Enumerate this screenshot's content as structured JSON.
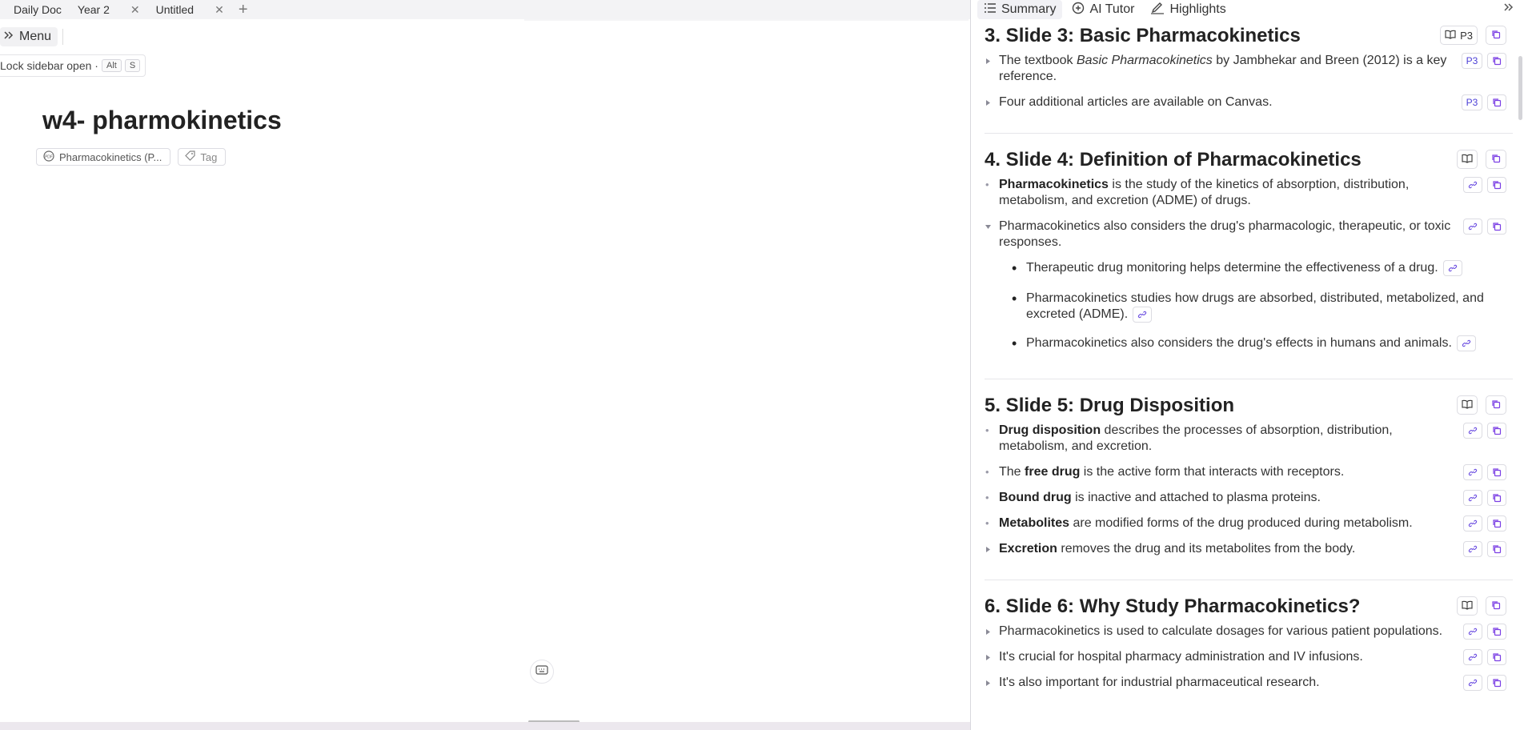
{
  "tabs": [
    {
      "label": "Daily Doc",
      "closable": false
    },
    {
      "label": "Year 2",
      "closable": true
    },
    {
      "label": "Untitled",
      "closable": true
    }
  ],
  "sidebar": {
    "menu_label": "Menu",
    "lock_tip": "Lock sidebar open ·",
    "lock_keys": [
      "Alt",
      "S"
    ]
  },
  "document": {
    "title": "w4- pharmokinetics",
    "pdf_chip": "Pharmacokinetics (P...",
    "tag_chip": "Tag"
  },
  "panel": {
    "tabs": [
      {
        "label": "Summary",
        "icon": "list-icon"
      },
      {
        "label": "AI Tutor",
        "icon": "plus-circle-icon"
      },
      {
        "label": "Highlights",
        "icon": "highlighter-icon"
      }
    ],
    "sections": [
      {
        "title": "3. Slide 3: Basic Pharmacokinetics",
        "page_badge": "P3",
        "items": [
          {
            "marker": "caret",
            "html": "The textbook <i>Basic Pharmacokinetics</i> by Jambhekar and Breen (2012) is a key reference.",
            "badge": "P3"
          },
          {
            "marker": "caret",
            "html": "Four additional articles are available on Canvas.",
            "badge": "P3"
          }
        ]
      },
      {
        "title": "4. Slide 4: Definition of Pharmacokinetics",
        "items": [
          {
            "marker": "dot",
            "html": "<b>Pharmacokinetics</b> is the study of the kinetics of absorption, distribution, metabolism, and excretion (ADME) of drugs."
          },
          {
            "marker": "open",
            "html": "Pharmacokinetics also considers the drug's pharmacologic, therapeutic, or toxic responses.",
            "sub": [
              "Therapeutic drug monitoring helps determine the effectiveness of a drug.",
              "Pharmacokinetics studies how drugs are absorbed, distributed, metabolized, and excreted (ADME).",
              "Pharmacokinetics also considers the drug's effects in humans and animals."
            ]
          }
        ]
      },
      {
        "title": "5. Slide 5: Drug Disposition",
        "items": [
          {
            "marker": "dot",
            "html": "<b>Drug disposition</b> describes the processes of absorption, distribution, metabolism, and excretion."
          },
          {
            "marker": "dot",
            "html": "The <b>free drug</b> is the active form that interacts with receptors."
          },
          {
            "marker": "dot",
            "html": "<b>Bound drug</b> is inactive and attached to plasma proteins."
          },
          {
            "marker": "dot",
            "html": "<b>Metabolites</b> are modified forms of the drug produced during metabolism."
          },
          {
            "marker": "caret",
            "html": "<b>Excretion</b> removes the drug and its metabolites from the body."
          }
        ]
      },
      {
        "title": "6. Slide 6: Why Study Pharmacokinetics?",
        "items": [
          {
            "marker": "caret",
            "html": "Pharmacokinetics is used to calculate dosages for various patient populations."
          },
          {
            "marker": "caret",
            "html": "It's crucial for hospital pharmacy administration and IV infusions."
          },
          {
            "marker": "caret",
            "html": "It's also important for industrial pharmaceutical research."
          }
        ]
      }
    ]
  },
  "colors": {
    "accent": "#7b3fe4",
    "divider": "#d8d8de"
  }
}
